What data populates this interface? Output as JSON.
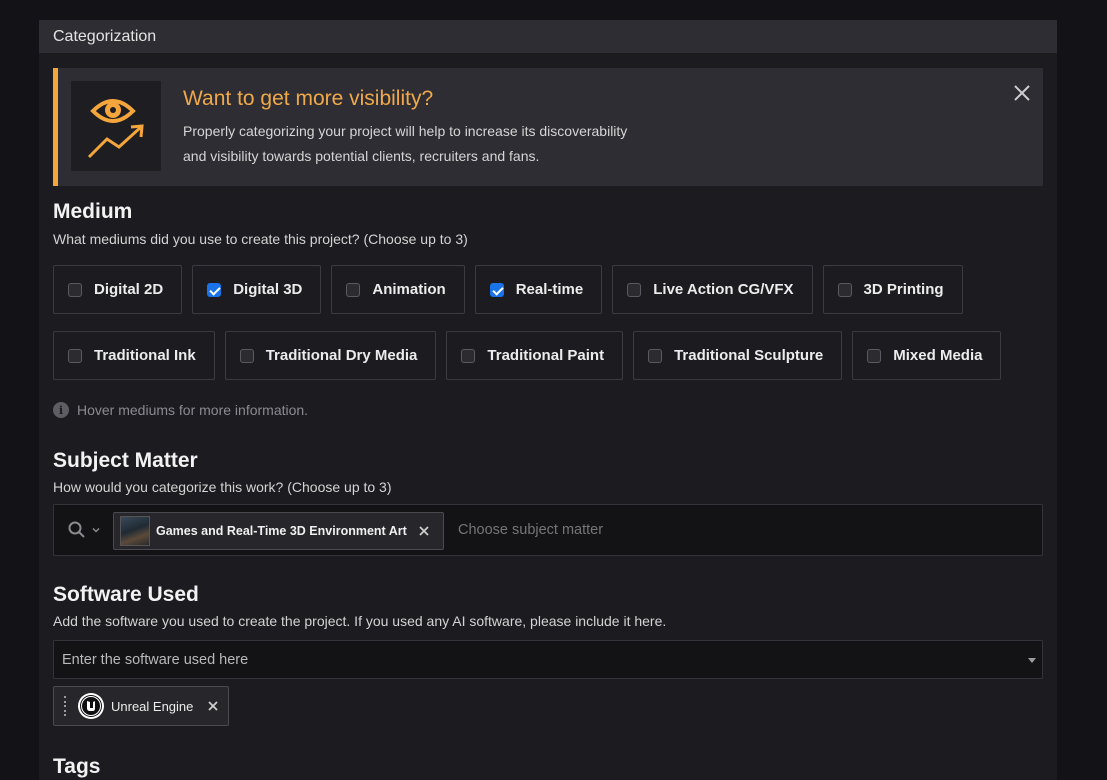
{
  "panel": {
    "title": "Categorization"
  },
  "callout": {
    "title": "Want to get more visibility?",
    "text_line1": "Properly categorizing your project will help to increase its discoverability",
    "text_line2": "and visibility towards potential clients, recruiters and fans.",
    "accent_color": "#f4a53c",
    "icon": "eye-trending-up-icon",
    "close_icon": "close-icon"
  },
  "medium": {
    "title": "Medium",
    "subtitle": "What mediums did you use to create this project? (Choose up to 3)",
    "row1": [
      {
        "label": "Digital 2D",
        "checked": false
      },
      {
        "label": "Digital 3D",
        "checked": true
      },
      {
        "label": "Animation",
        "checked": false
      },
      {
        "label": "Real-time",
        "checked": true
      },
      {
        "label": "Live Action CG/VFX",
        "checked": false
      },
      {
        "label": "3D Printing",
        "checked": false
      }
    ],
    "row2": [
      {
        "label": "Traditional Ink",
        "checked": false
      },
      {
        "label": "Traditional Dry Media",
        "checked": false
      },
      {
        "label": "Traditional Paint",
        "checked": false
      },
      {
        "label": "Traditional Sculpture",
        "checked": false
      },
      {
        "label": "Mixed Media",
        "checked": false
      }
    ],
    "hint": "Hover mediums for more information."
  },
  "subject": {
    "title": "Subject Matter",
    "subtitle": "How would you categorize this work? (Choose up to 3)",
    "selected_tag": "Games and Real-Time 3D Environment Art",
    "placeholder": "Choose subject matter"
  },
  "software": {
    "title": "Software Used",
    "subtitle": "Add the software you used to create the project. If you used any AI software, please include it here.",
    "placeholder": "Enter the software used here",
    "selected": "Unreal Engine"
  },
  "tags": {
    "title": "Tags"
  },
  "colors": {
    "checked": "#1a73e8",
    "panel": "#1c1c20",
    "header": "#2d2d33"
  }
}
